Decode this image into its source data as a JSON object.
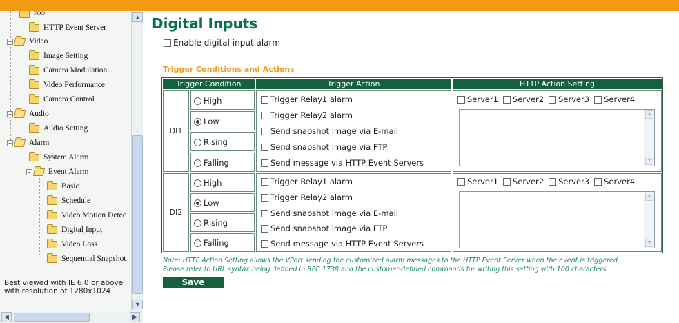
{
  "colors": {
    "topbar": "#f39a13",
    "accent_green": "#14603f",
    "title_green": "#0c6e4f",
    "section_orange": "#f19a1b"
  },
  "sidebar": {
    "partial_top_item": "FOO",
    "items": [
      {
        "label": "HTTP Event Server",
        "icon": "folder-icon"
      },
      {
        "label": "Video",
        "icon": "folder-open-icon",
        "expander": "−"
      },
      {
        "label": "Image Setting",
        "icon": "folder-icon"
      },
      {
        "label": "Camera Modulation",
        "icon": "folder-icon"
      },
      {
        "label": "Video Performance",
        "icon": "folder-icon"
      },
      {
        "label": "Camera Control",
        "icon": "folder-icon"
      },
      {
        "label": "Audio",
        "icon": "folder-open-icon",
        "expander": "−"
      },
      {
        "label": "Audio Setting",
        "icon": "folder-icon"
      },
      {
        "label": "Alarm",
        "icon": "folder-open-icon",
        "expander": "−"
      },
      {
        "label": "System Alarm",
        "icon": "folder-icon"
      },
      {
        "label": "Event Alarm",
        "icon": "folder-open-icon",
        "expander": "−"
      },
      {
        "label": "Basic",
        "icon": "folder-icon"
      },
      {
        "label": "Schedule",
        "icon": "folder-icon"
      },
      {
        "label": "Video Motion Detec",
        "icon": "folder-icon"
      },
      {
        "label": "Digital Input",
        "icon": "folder-icon"
      },
      {
        "label": "Video Loss",
        "icon": "folder-icon"
      },
      {
        "label": "Sequential Snapshot",
        "icon": "folder-icon"
      }
    ],
    "best_viewed": "Best viewed with IE 6.0 or above with resolution of 1280x1024"
  },
  "main": {
    "title": "Digital Inputs",
    "enable_label": "Enable digital input alarm",
    "section_title": "Trigger Conditions and Actions",
    "headers": {
      "condition": "Trigger Condition",
      "action": "Trigger Action",
      "http": "HTTP Action Setting"
    },
    "inputs": [
      {
        "label": "DI1",
        "conditions": [
          "High",
          "Low",
          "Rising",
          "Falling"
        ],
        "selected": "Low",
        "actions": [
          "Trigger Relay1 alarm",
          "Trigger Relay2 alarm",
          "Send snapshot image via E-mail",
          "Send snapshot image via FTP",
          "Send message via HTTP Event Servers"
        ],
        "servers": [
          "Server1",
          "Server2",
          "Server3",
          "Server4"
        ]
      },
      {
        "label": "DI2",
        "conditions": [
          "High",
          "Low",
          "Rising",
          "Falling"
        ],
        "selected": "Low",
        "actions": [
          "Trigger Relay1 alarm",
          "Trigger Relay2 alarm",
          "Send snapshot image via E-mail",
          "Send snapshot image via FTP",
          "Send message via HTTP Event Servers"
        ],
        "servers": [
          "Server1",
          "Server2",
          "Server3",
          "Server4"
        ]
      }
    ],
    "note_line1": "Note: HTTP Action Setting allows the VPort sending the customized alarm messages to the HTTP Event Server when the event is triggered.",
    "note_line2": "Please refer to URL syntax being defined in RFC 1738 and the customer-defined commands for writing this setting with 100 characters.",
    "save_label": "Save"
  }
}
